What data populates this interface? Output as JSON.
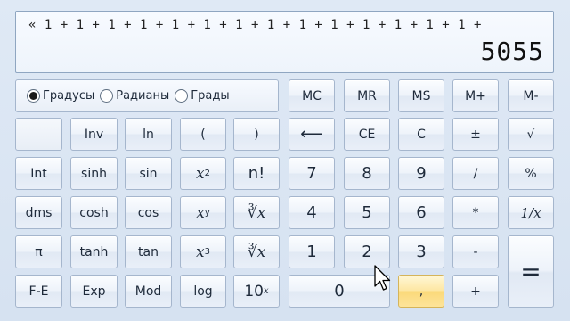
{
  "display": {
    "expression": "« 1 + 1 + 1 + 1 + 1 + 1 + 1 + 1 + 1 + 1 + 1 + 1 + 1 + 1 +",
    "result": "5055"
  },
  "angle_modes": {
    "degrees": "Градусы",
    "radians": "Радианы",
    "grads": "Грады",
    "selected": "degrees"
  },
  "memory": {
    "mc": "MC",
    "mr": "MR",
    "ms": "MS",
    "mplus": "M+",
    "mminus": "M-"
  },
  "sci": {
    "inv": "Inv",
    "ln": "ln",
    "lparen": "(",
    "rparen": ")",
    "int": "Int",
    "sinh": "sinh",
    "sin": "sin",
    "x2": "x",
    "x2_sup": "2",
    "nfact": "n!",
    "dms": "dms",
    "cosh": "cosh",
    "cos": "cos",
    "xy": "x",
    "xy_sup": "y",
    "yroot": "∛x",
    "pi": "π",
    "tanh": "tanh",
    "tan": "tan",
    "x3": "x",
    "x3_sup": "3",
    "cuberoot": "∛x",
    "fe": "F-E",
    "exp": "Exp",
    "mod": "Mod",
    "log": "log",
    "tenx": "10",
    "tenx_sup": "x"
  },
  "edit": {
    "backspace": "⟵",
    "ce": "CE",
    "c": "C",
    "plusminus": "±",
    "sqrt": "√"
  },
  "digits": {
    "d7": "7",
    "d8": "8",
    "d9": "9",
    "d4": "4",
    "d5": "5",
    "d6": "6",
    "d1": "1",
    "d2": "2",
    "d3": "3",
    "d0": "0"
  },
  "ops": {
    "div": "/",
    "percent": "%",
    "mul": "*",
    "recip": "1/x",
    "minus": "-",
    "plus": "+",
    "equals": "=",
    "decimal": ","
  }
}
